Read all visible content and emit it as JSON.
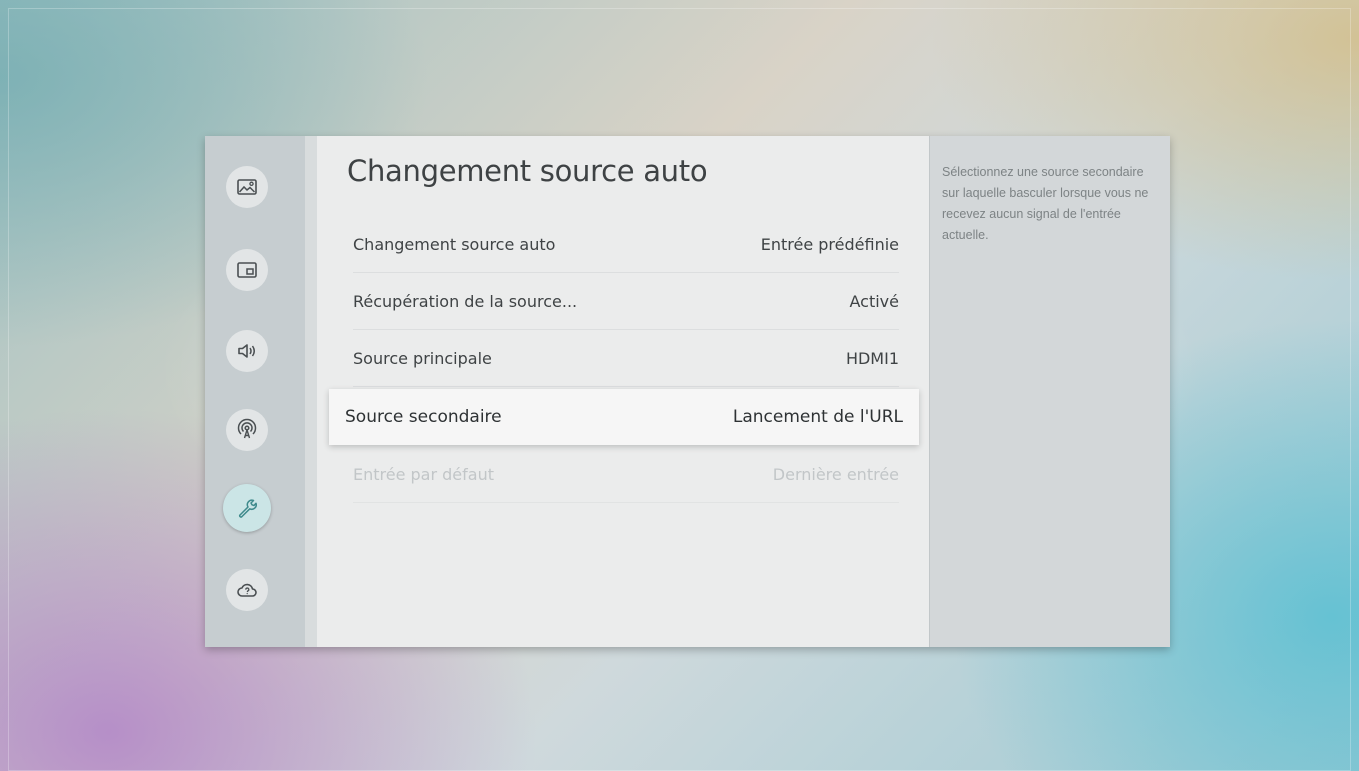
{
  "sidebar": {
    "items": [
      {
        "icon": "picture-icon",
        "active": false
      },
      {
        "icon": "pip-screen-icon",
        "active": false
      },
      {
        "icon": "speaker-icon",
        "active": false
      },
      {
        "icon": "broadcast-icon",
        "active": false
      },
      {
        "icon": "wrench-icon",
        "active": true
      },
      {
        "icon": "support-cloud-icon",
        "active": false
      }
    ]
  },
  "main": {
    "title": "Changement source auto",
    "rows": [
      {
        "label": "Changement source auto",
        "value": "Entrée prédéfinie",
        "state": "normal"
      },
      {
        "label": "Récupération de la source...",
        "value": "Activé",
        "state": "normal"
      },
      {
        "label": "Source principale",
        "value": "HDMI1",
        "state": "normal"
      },
      {
        "label": "Source secondaire",
        "value": "Lancement de l'URL",
        "state": "selected"
      },
      {
        "label": "Entrée par défaut",
        "value": "Dernière entrée",
        "state": "disabled"
      }
    ]
  },
  "help": {
    "text": "Sélectionnez une source secondaire sur laquelle basculer lorsque vous ne recevez aucun signal de l'entrée actuelle."
  },
  "colors": {
    "sidebar_bg": "#c6cdd0",
    "main_bg": "#ebecec",
    "help_bg": "#d3d7d9",
    "active_icon_bg": "#cbe5e6",
    "icon_stroke": "#4a4f52"
  }
}
